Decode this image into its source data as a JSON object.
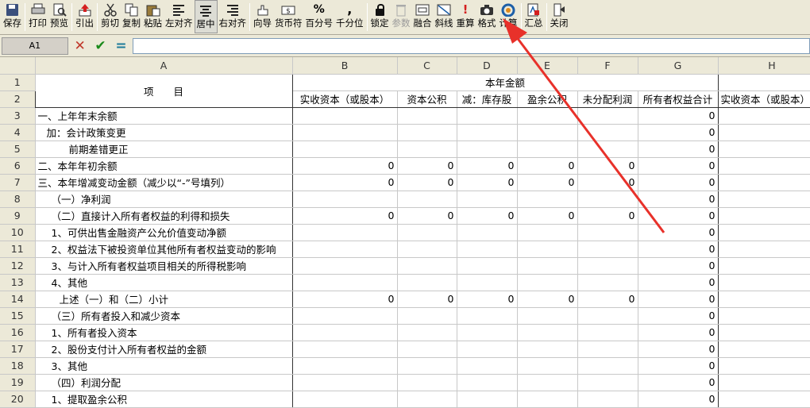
{
  "toolbar": {
    "buttons": [
      {
        "label": "保存",
        "icon": "save-icon"
      },
      {
        "label": "打印",
        "icon": "print-icon"
      },
      {
        "label": "预览",
        "icon": "preview-icon"
      },
      {
        "label": "引出",
        "icon": "export-icon"
      },
      {
        "label": "剪切",
        "icon": "cut-icon"
      },
      {
        "label": "复制",
        "icon": "copy-icon"
      },
      {
        "label": "粘贴",
        "icon": "paste-icon"
      },
      {
        "label": "左对齐",
        "icon": "align-left-icon"
      },
      {
        "label": "居中",
        "icon": "align-center-icon"
      },
      {
        "label": "右对齐",
        "icon": "align-right-icon"
      },
      {
        "label": "向导",
        "icon": "wizard-icon"
      },
      {
        "label": "货币符",
        "icon": "currency-icon"
      },
      {
        "label": "百分号",
        "icon": "percent-icon"
      },
      {
        "label": "千分位",
        "icon": "thousands-icon"
      },
      {
        "label": "锁定",
        "icon": "lock-icon"
      },
      {
        "label": "参数",
        "icon": "parameter-icon"
      },
      {
        "label": "融合",
        "icon": "merge-icon"
      },
      {
        "label": "斜线",
        "icon": "diagonal-icon"
      },
      {
        "label": "重算",
        "icon": "recalc-icon"
      },
      {
        "label": "格式",
        "icon": "format-icon"
      },
      {
        "label": "计算",
        "icon": "calculate-icon"
      },
      {
        "label": "汇总",
        "icon": "summary-icon"
      },
      {
        "label": "关闭",
        "icon": "close-icon"
      }
    ]
  },
  "formula_bar": {
    "cell_ref": "A1",
    "formula": ""
  },
  "columns": [
    "A",
    "B",
    "C",
    "D",
    "E",
    "F",
    "G",
    "H"
  ],
  "header": {
    "item": "项　　目",
    "group": "本年金额",
    "subcols": [
      "实收资本（或股本）",
      "资本公积",
      "减：库存股",
      "盈余公积",
      "未分配利润",
      "所有者权益合计",
      "实收资本（或股本）"
    ]
  },
  "rows": [
    {
      "num": "1"
    },
    {
      "num": "2"
    },
    {
      "num": "3",
      "item": "一、上年年末余额",
      "values": [
        "",
        "",
        "",
        "",
        "",
        "0",
        ""
      ]
    },
    {
      "num": "4",
      "item": "加：会计政策变更",
      "values": [
        "",
        "",
        "",
        "",
        "",
        "0",
        ""
      ]
    },
    {
      "num": "5",
      "item": "前期差错更正",
      "values": [
        "",
        "",
        "",
        "",
        "",
        "0",
        ""
      ]
    },
    {
      "num": "6",
      "item": "二、本年年初余额",
      "values": [
        "0",
        "0",
        "0",
        "0",
        "0",
        "0",
        ""
      ]
    },
    {
      "num": "7",
      "item": "三、本年增减变动金额（减少以“-”号填列）",
      "values": [
        "0",
        "0",
        "0",
        "0",
        "0",
        "0",
        ""
      ]
    },
    {
      "num": "8",
      "item": "（一）净利润",
      "values": [
        "",
        "",
        "",
        "",
        "",
        "0",
        ""
      ]
    },
    {
      "num": "9",
      "item": "（二）直接计入所有者权益的利得和损失",
      "values": [
        "0",
        "0",
        "0",
        "0",
        "0",
        "0",
        ""
      ]
    },
    {
      "num": "10",
      "item": "1、可供出售金融资产公允价值变动净额",
      "values": [
        "",
        "",
        "",
        "",
        "",
        "0",
        ""
      ]
    },
    {
      "num": "11",
      "item": "2、权益法下被投资单位其他所有者权益变动的影响",
      "values": [
        "",
        "",
        "",
        "",
        "",
        "0",
        ""
      ]
    },
    {
      "num": "12",
      "item": "3、与计入所有者权益项目相关的所得税影响",
      "values": [
        "",
        "",
        "",
        "",
        "",
        "0",
        ""
      ]
    },
    {
      "num": "13",
      "item": "4、其他",
      "values": [
        "",
        "",
        "",
        "",
        "",
        "0",
        ""
      ]
    },
    {
      "num": "14",
      "item": "上述（一）和（二）小计",
      "values": [
        "0",
        "0",
        "0",
        "0",
        "0",
        "0",
        ""
      ]
    },
    {
      "num": "15",
      "item": "（三）所有者投入和减少资本",
      "values": [
        "",
        "",
        "",
        "",
        "",
        "0",
        ""
      ]
    },
    {
      "num": "16",
      "item": "1、所有者投入资本",
      "values": [
        "",
        "",
        "",
        "",
        "",
        "0",
        ""
      ]
    },
    {
      "num": "17",
      "item": "2、股份支付计入所有者权益的金额",
      "values": [
        "",
        "",
        "",
        "",
        "",
        "0",
        ""
      ]
    },
    {
      "num": "18",
      "item": "3、其他",
      "values": [
        "",
        "",
        "",
        "",
        "",
        "0",
        ""
      ]
    },
    {
      "num": "19",
      "item": "（四）利润分配",
      "values": [
        "",
        "",
        "",
        "",
        "",
        "0",
        ""
      ]
    },
    {
      "num": "20",
      "item": "1、提取盈余公积",
      "values": [
        "",
        "",
        "",
        "",
        "",
        "0",
        ""
      ]
    }
  ],
  "colors": {
    "toolbar_bg": "#ece9d8",
    "annotation_arrow": "#e8312a",
    "cancel_x": "#c0392b",
    "accept_check": "#1a8a1a",
    "formula_eq": "#1d7a9a"
  }
}
